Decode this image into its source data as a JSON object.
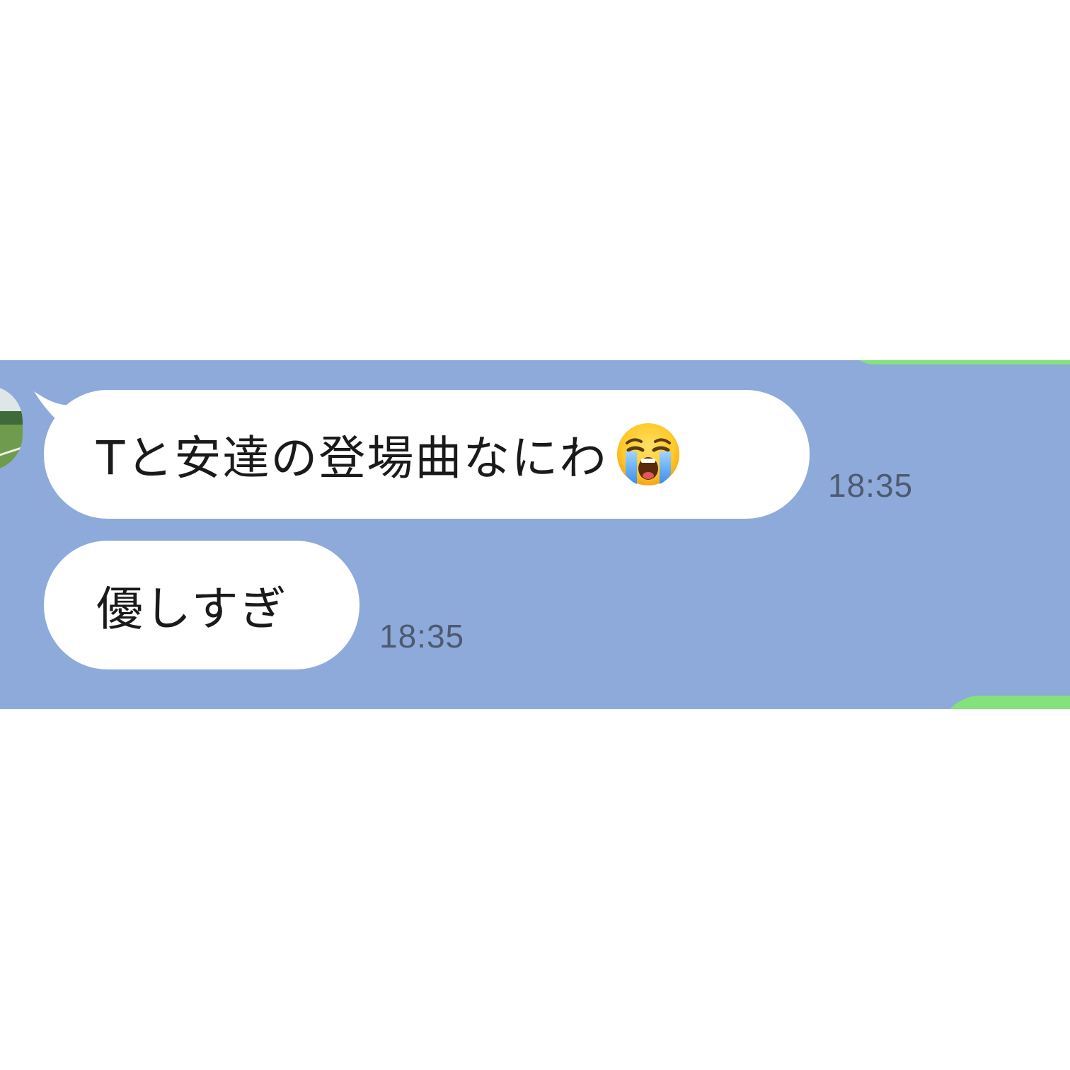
{
  "chat": {
    "messages": [
      {
        "text": "Tと安達の登場曲なにわ",
        "emoji": "loudly-crying-face",
        "time": "18:35"
      },
      {
        "text": "優しすぎ",
        "time": "18:35"
      }
    ]
  },
  "colors": {
    "chat_background": "#8eaada",
    "received_bubble": "#ffffff",
    "sent_bubble": "#84e27a",
    "timestamp_text": "#4e5a70",
    "page_background": "#ffffff"
  }
}
